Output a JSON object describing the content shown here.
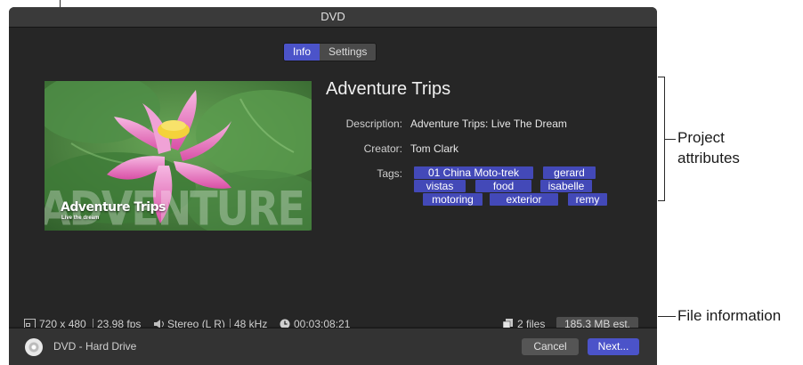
{
  "window": {
    "title": "DVD"
  },
  "tabs": [
    {
      "label": "Info",
      "active": true
    },
    {
      "label": "Settings",
      "active": false
    }
  ],
  "project": {
    "title": "Adventure Trips",
    "description_label": "Description:",
    "description": "Adventure Trips: Live The Dream",
    "creator_label": "Creator:",
    "creator": "Tom Clark",
    "tags_label": "Tags:",
    "tags": [
      "01 China Moto-trek",
      "gerard",
      "vistas",
      "food",
      "isabelle",
      "motoring",
      "exterior",
      "remy"
    ]
  },
  "thumbnail": {
    "title": "Adventure Trips",
    "subtitle": "Live the dream",
    "watermark": "ADVENTURE TRIPS"
  },
  "file_info": {
    "resolution": "720 x 480",
    "frame_rate": "23.98 fps",
    "audio": "Stereo (L R)",
    "sample_rate": "48 kHz",
    "duration": "00:03:08:21",
    "files": "2 files",
    "size": "185.3 MB est."
  },
  "footer": {
    "destination": "DVD - Hard Drive",
    "cancel": "Cancel",
    "next": "Next..."
  },
  "annotations": {
    "project_attributes_line1": "Project",
    "project_attributes_line2": "attributes",
    "file_information": "File information"
  },
  "colors": {
    "accent": "#4b53c9",
    "tag": "#4349b8",
    "background": "#262626"
  }
}
